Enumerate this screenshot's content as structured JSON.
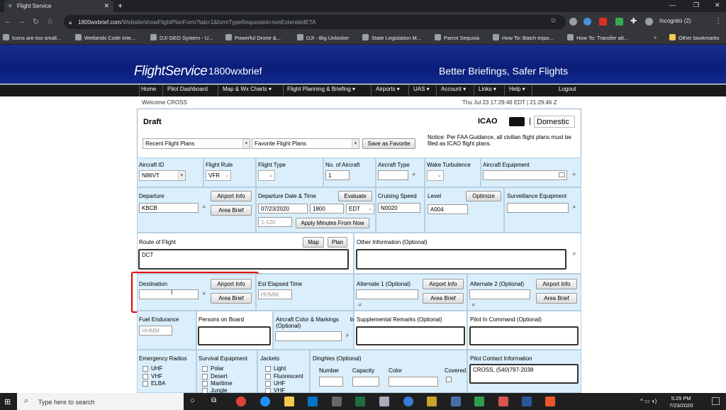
{
  "browser": {
    "tab_title": "Flight Service",
    "url_host": "1800wxbrief.com",
    "url_path": "/Website/showFlightPlanForm?tab=1&formTypeRequested=nonExtendedETA",
    "incognito_label": "Incognito (2)",
    "bookmarks": [
      "Icons are too small...",
      "Wetlands Code Inte...",
      "DJI GEO System - U...",
      "Powerful Drone &...",
      "DJI - Big Unlocker",
      "State Legislation M...",
      "Parrot Sequoia",
      "How To: Batch expo...",
      "How To: Transfer att...",
      "Other bookmarks"
    ]
  },
  "site": {
    "logo_main": "FlightService",
    "logo_domain": "1800wxbrief",
    "tagline": "Better Briefings, Safer Flights",
    "nav": [
      "Home",
      "Pilot Dashboard",
      "Map & Wx Charts ▾",
      "Flight Planning & Briefing ▾",
      "Airports ▾",
      "UAS ▾",
      "Account ▾",
      "Links ▾",
      "Help ▾",
      "Logout"
    ],
    "welcome": "Welcome CROSS",
    "datetime": "Thu Jul 23 17:29:46 EDT | 21:29:46 Z"
  },
  "form": {
    "title": "Draft",
    "icao": "ICAO",
    "pipe": "|",
    "domestic": "Domestic",
    "notice": "Notice: Per FAA Guidance, all civilian flight plans must be filed as ICAO flight plans.",
    "recent_plans": "Recent Flight Plans",
    "favorite_plans": "Favorite Flight Plans",
    "save_favorite": "Save as Favorite",
    "aircraft_id_label": "Aircraft ID",
    "aircraft_id": "N86VT",
    "flight_rule_label": "Flight Rule",
    "flight_rule": "VFR",
    "flight_type_label": "Flight Type",
    "num_aircraft_label": "No. of Aircraft",
    "num_aircraft": "1",
    "aircraft_type_label": "Aircraft Type",
    "wake_label": "Wake Turbulence",
    "equipment_label": "Aircraft Equipment",
    "departure_label": "Departure",
    "departure": "KBCB",
    "airport_info": "Airport Info",
    "area_brief": "Area Brief",
    "dep_dt_label": "Departure Date & Time",
    "evaluate": "Evaluate",
    "dep_date": "07/23/2020",
    "dep_time": "1800",
    "dep_tz": "EDT",
    "minutes_placeholder": "1-120",
    "apply_minutes": "Apply Minutes From Now",
    "cruise_label": "Cruising Speed",
    "cruise": "N0020",
    "level_label": "Level",
    "optimize": "Optimize",
    "level": "A004",
    "surv_label": "Surveillance Equipment",
    "route_label": "Route of Flight",
    "map": "Map",
    "plan": "Plan",
    "route": "DCT",
    "other_info_label": "Other Information (Optional)",
    "destination_label": "Destination",
    "ete_label": "Est Elapsed Time",
    "ete_placeholder": "HHMM",
    "alt1_label": "Alternate 1 (Optional)",
    "alt2_label": "Alternate 2 (Optional)",
    "fuel_label": "Fuel Endurance",
    "fuel_placeholder": "HHMM",
    "persons_label": "Persons on Board",
    "color_label": "Aircraft Color & Markings (Optional)",
    "remarks_label": "Supplemental Remarks (Optional)",
    "pic_label": "Pilot In Command (Optional)",
    "radios_label": "Emergency Radios",
    "radios": [
      "UHF",
      "VHF",
      "ELBA"
    ],
    "survival_label": "Survival Equipment",
    "survival": [
      "Polar",
      "Desert",
      "Maritime",
      "Jungle"
    ],
    "jackets_label": "Jackets",
    "jackets": [
      "Light",
      "Fluorescent",
      "UHF",
      "VHF"
    ],
    "dinghies_label": "Dinghies (Optional)",
    "dinghy_number": "Number",
    "dinghy_capacity": "Capacity",
    "dinghy_color": "Color",
    "dinghy_covered": "Covered",
    "contact_label": "Pilot Contact Information",
    "contact": "CROSS, (540)797-2038"
  },
  "taskbar": {
    "search": "Type here to search",
    "time": "5:29 PM",
    "date": "7/23/2020"
  }
}
